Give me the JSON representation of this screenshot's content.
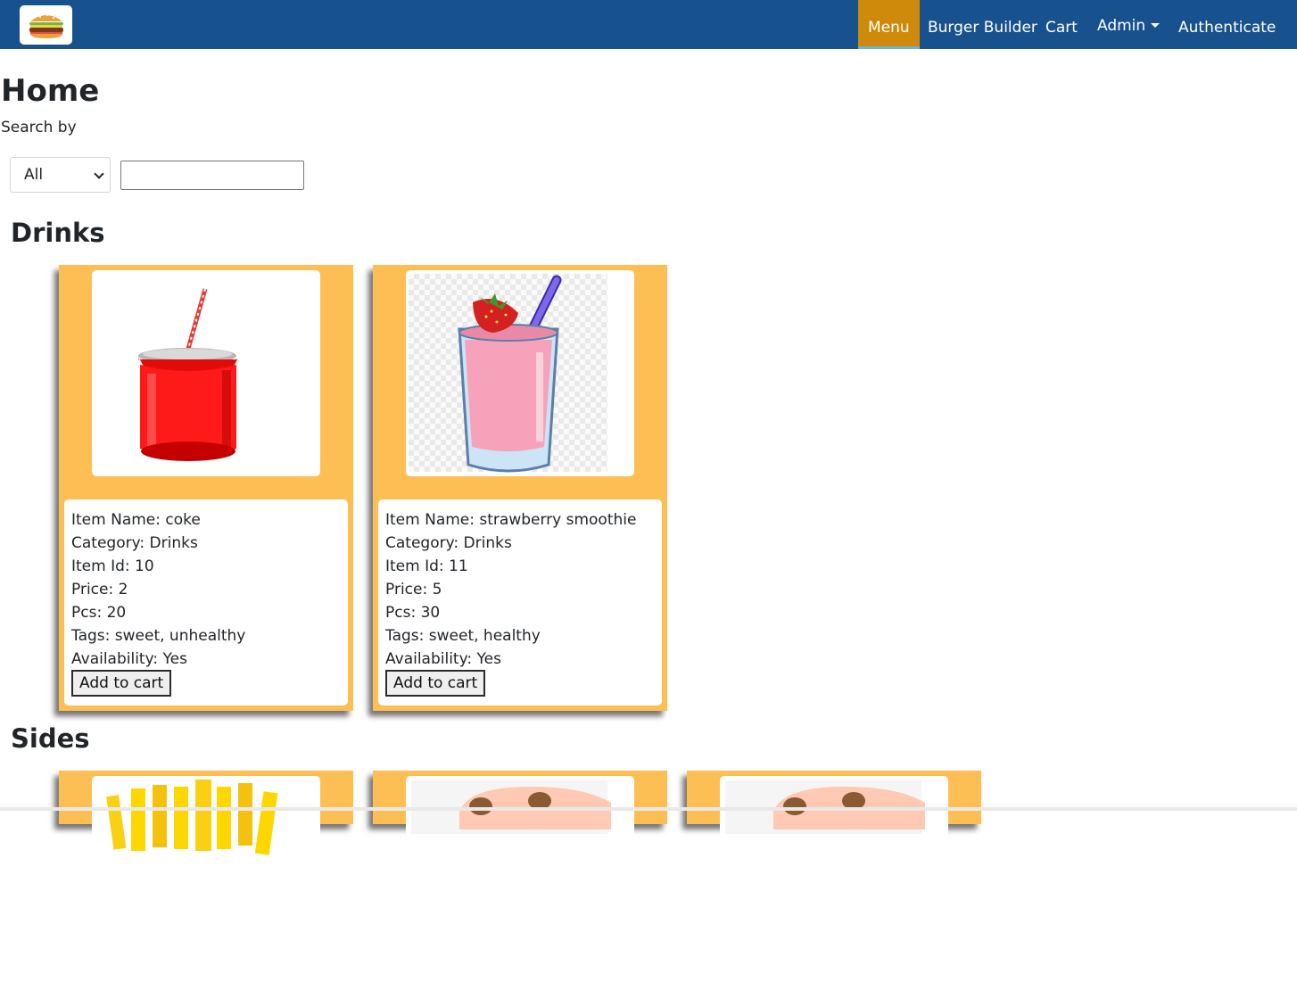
{
  "navbar": {
    "items": [
      {
        "label": "Menu",
        "active": true
      },
      {
        "label": "Burger Builder"
      },
      {
        "label": "Cart"
      },
      {
        "label": "Admin"
      },
      {
        "label": "Authenticate"
      }
    ],
    "brand_icon": "burger-icon",
    "color": "#18528e",
    "active_color": "#cf8a0b"
  },
  "page": {
    "title": "Home",
    "search_label": "Search by",
    "search_select": "All",
    "search_value": ""
  },
  "sections": [
    {
      "title": "Drinks",
      "items": [
        {
          "image_icon": "coke-can-icon",
          "name": "Item Name: coke",
          "category": "Category: Drinks",
          "id": "Item Id: 10",
          "price": "Price: 2",
          "pcs": "Pcs: 20",
          "tags": "Tags: sweet, unhealthy",
          "availability": "Availability: Yes",
          "button": "Add to cart"
        },
        {
          "image_icon": "strawberry-smoothie-icon",
          "name": "Item Name: strawberry smoothie",
          "category": "Category: Drinks",
          "id": "Item Id: 11",
          "price": "Price: 5",
          "pcs": "Pcs: 30",
          "tags": "Tags: sweet, healthy",
          "availability": "Availability: Yes",
          "button": "Add to cart"
        }
      ]
    },
    {
      "title": "Sides",
      "items": [
        {
          "image_icon": "fries-icon"
        },
        {
          "image_icon": "side-dish-icon"
        },
        {
          "image_icon": "side-dish-icon"
        }
      ]
    }
  ],
  "colors": {
    "card": "#fdbf54"
  }
}
